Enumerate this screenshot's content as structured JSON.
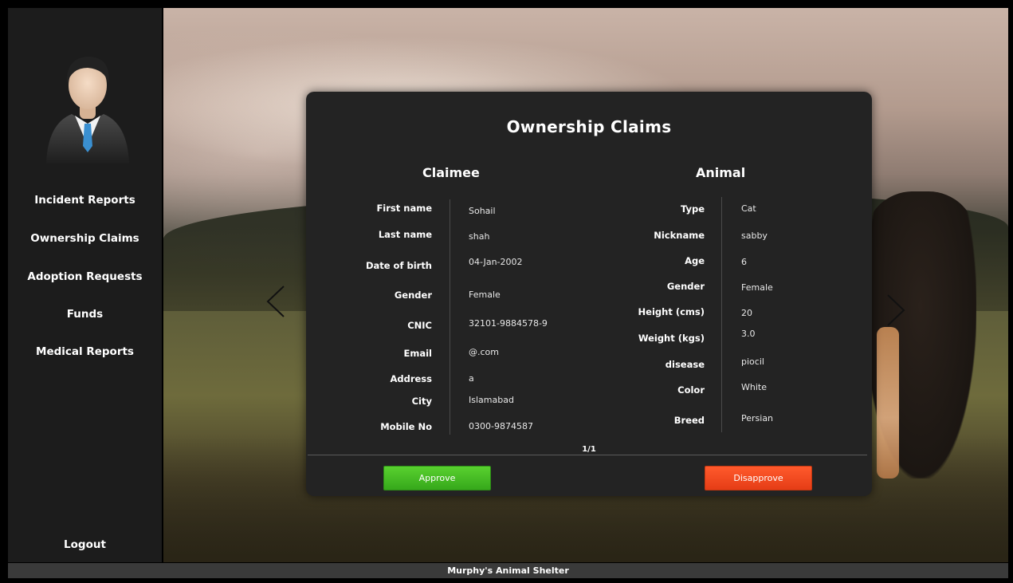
{
  "sidebar": {
    "items": [
      {
        "label": "Incident Reports"
      },
      {
        "label": "Ownership Claims"
      },
      {
        "label": "Adoption Requests"
      },
      {
        "label": "Funds"
      },
      {
        "label": "Medical Reports"
      }
    ],
    "logout_label": "Logout"
  },
  "modal": {
    "title": "Ownership Claims",
    "claimee": {
      "heading": "Claimee",
      "fields": [
        {
          "label": "First name",
          "value": "Sohail"
        },
        {
          "label": "Last name",
          "value": "shah"
        },
        {
          "label": "Date of birth",
          "value": "04-Jan-2002"
        },
        {
          "label": "Gender",
          "value": "Female"
        },
        {
          "label": "CNIC",
          "value": "32101-9884578-9"
        },
        {
          "label": "Email",
          "value": "@.com"
        },
        {
          "label": "Address",
          "value": "a"
        },
        {
          "label": "City",
          "value": "Islamabad"
        },
        {
          "label": "Mobile No",
          "value": "0300-9874587"
        }
      ]
    },
    "animal": {
      "heading": "Animal",
      "fields": [
        {
          "label": "Type",
          "value": "Cat"
        },
        {
          "label": "Nickname",
          "value": "sabby"
        },
        {
          "label": "Age",
          "value": "6"
        },
        {
          "label": "Gender",
          "value": "Female"
        },
        {
          "label": "Height (cms)",
          "value": "20"
        },
        {
          "label": "Weight (kgs)",
          "value": "3.0"
        },
        {
          "label": "disease",
          "value": "piocil"
        },
        {
          "label": "Color",
          "value": "White"
        },
        {
          "label": "Breed",
          "value": "Persian"
        }
      ]
    },
    "pager": "1/1",
    "approve_label": "Approve",
    "disapprove_label": "Disapprove"
  },
  "footer": {
    "text": "Murphy's Animal Shelter"
  },
  "icons": {
    "avatar": "user-avatar-icon",
    "prev": "chevron-left-icon",
    "next": "chevron-right-icon"
  },
  "colors": {
    "approve": "#3fbc20",
    "disapprove": "#f24a1f",
    "sidebar": "#1c1c1c",
    "modal": "#232323"
  }
}
